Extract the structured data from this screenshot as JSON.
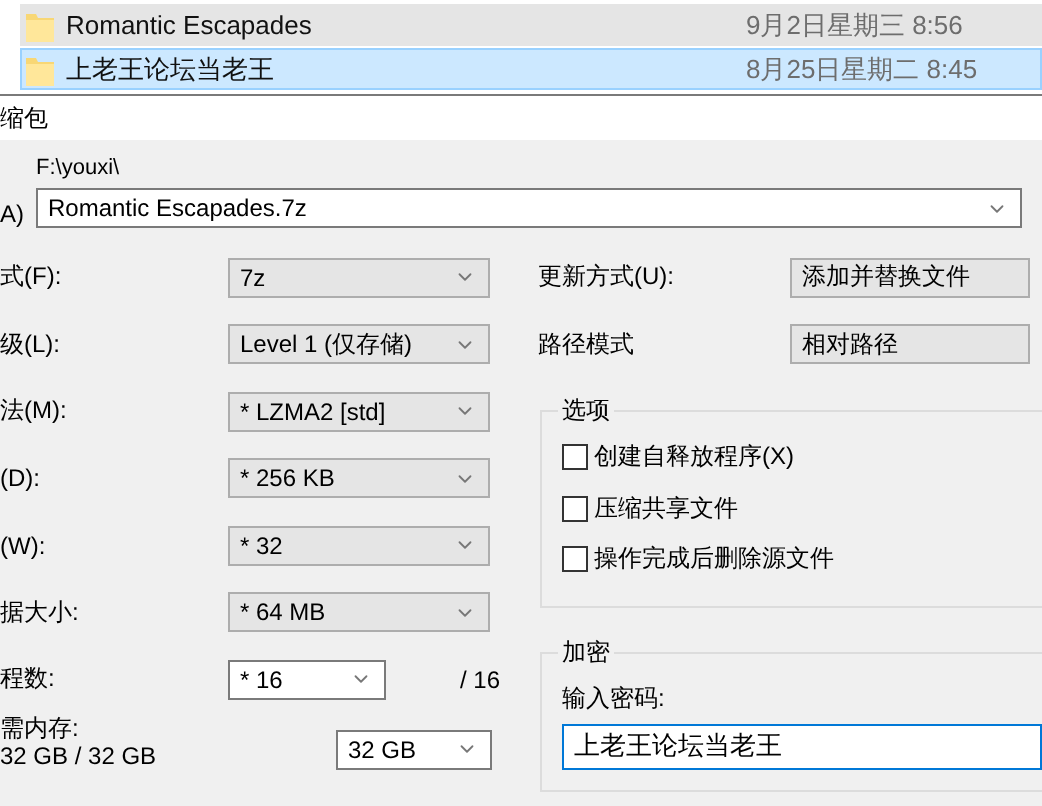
{
  "file_list": [
    {
      "name": "Romantic Escapades",
      "date": "9月2日星期三 8:56",
      "hovered": true,
      "selected": false
    },
    {
      "name": "上老王论坛当老王",
      "date": "8月25日星期二 8:45",
      "hovered": false,
      "selected": true
    }
  ],
  "dialog": {
    "title": "缩包",
    "archive_label": "A)",
    "path": "F:\\youxi\\",
    "archive_name": "Romantic Escapades.7z",
    "left_fields": [
      {
        "kind": "combo",
        "label": "式(F):",
        "value": "7z"
      },
      {
        "kind": "combo",
        "label": "级(L):",
        "value": "Level 1 (仅存储)"
      },
      {
        "kind": "combo",
        "label": "法(M):",
        "value": "* LZMA2 [std]"
      },
      {
        "kind": "combo",
        "label": "(D):",
        "value": "* 256 KB"
      },
      {
        "kind": "combo",
        "label": "(W):",
        "value": "* 32"
      },
      {
        "kind": "combo",
        "label": "据大小:",
        "value": "* 64 MB"
      },
      {
        "kind": "threads",
        "label": "程数:",
        "value": "* 16",
        "suffix": "/ 16"
      }
    ],
    "memory": {
      "label": "需内存:",
      "usage": "32 GB / 32 GB",
      "value": "32 GB"
    },
    "right_fields": [
      {
        "label": "更新方式(U):",
        "value": "添加并替换文件"
      },
      {
        "label": "路径模式",
        "value": "相对路径"
      }
    ],
    "options": {
      "title": "选项",
      "items": [
        {
          "label": "创建自释放程序(X)",
          "checked": false
        },
        {
          "label": "压缩共享文件",
          "checked": false
        },
        {
          "label": "操作完成后删除源文件",
          "checked": false
        }
      ]
    },
    "encryption": {
      "title": "加密",
      "prompt": "输入密码:",
      "password": "上老王论坛当老王"
    }
  }
}
